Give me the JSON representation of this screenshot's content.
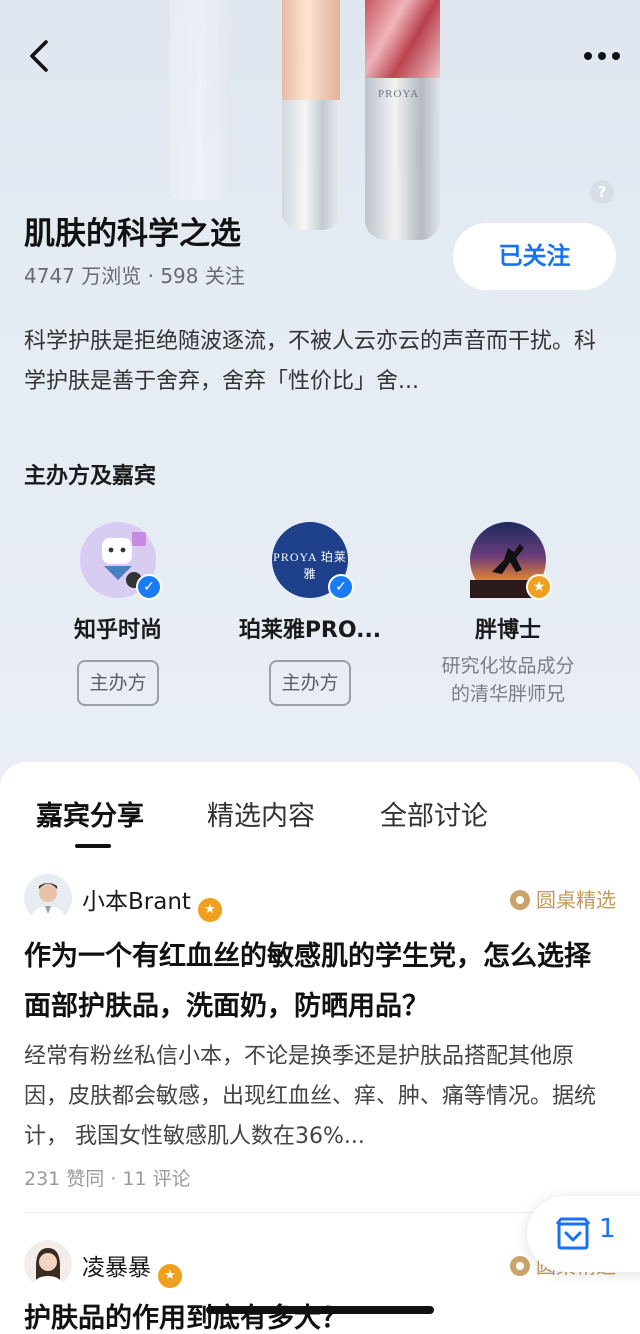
{
  "topic": {
    "title": "肌肤的科学之选",
    "stats": "4747 万浏览 · 598 关注",
    "follow_label": "已关注",
    "description": "科学护肤是拒绝随波逐流，不被人云亦云的声音而干扰。科学护肤是善于舍弃，舍弃「性价比」舍..."
  },
  "product_brand_text": "PROYA",
  "guests_section": {
    "heading": "主办方及嘉宾",
    "guests": [
      {
        "name": "知乎时尚",
        "tag": "主办方",
        "avatar_label": "知乎时尚"
      },
      {
        "name": "珀莱雅PRO...",
        "tag": "主办方",
        "avatar_label": "PROYA 珀莱雅"
      },
      {
        "name": "胖博士",
        "subtitle_line1": "研究化妆品成分",
        "subtitle_line2": "的清华胖师兄"
      }
    ]
  },
  "tabs": [
    {
      "label": "嘉宾分享",
      "active": true
    },
    {
      "label": "精选内容",
      "active": false
    },
    {
      "label": "全部讨论",
      "active": false
    }
  ],
  "posts": [
    {
      "author": "小本Brant",
      "tag": "圆桌精选",
      "title": "作为一个有红血丝的敏感肌的学生党，怎么选择面部护肤品，洗面奶，防晒用品？",
      "excerpt": "经常有粉丝私信小本，不论是换季还是护肤品搭配其他原因，皮肤都会敏感，出现红血丝、痒、肿、痛等情况。据统计， 我国女性敏感肌人数在36%...",
      "meta": "231 赞同 · 11 评论"
    },
    {
      "author": "凌暴暴",
      "tag": "圆桌精选",
      "title": "护肤品的作用到底有多大？"
    }
  ],
  "floating_button": {
    "count": "1"
  },
  "icons": {
    "back": "back-arrow-icon",
    "more": "more-dots-icon",
    "help": "help-icon",
    "verified": "verified-badge-icon",
    "roundtable": "roundtable-icon",
    "collection": "collection-box-icon"
  },
  "colors": {
    "accent": "#1772f6",
    "gold": "#c29a5a",
    "verified_blue": "#1a7cf2",
    "badge_gold": "#f0a01e"
  }
}
